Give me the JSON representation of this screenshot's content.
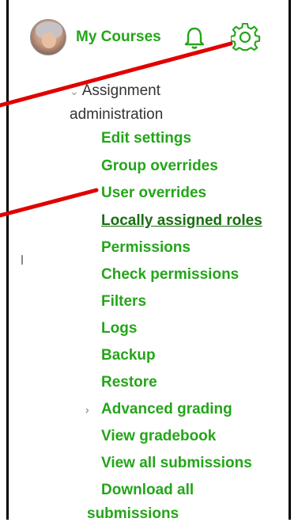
{
  "header": {
    "my_courses_label": "My Courses"
  },
  "icons": {
    "avatar": "user-avatar",
    "bell": "bell-icon",
    "gear": "gear-icon"
  },
  "section": {
    "title_line1": "Assignment",
    "title_line2": "administration"
  },
  "menu": {
    "items": [
      {
        "label": "Edit settings"
      },
      {
        "label": "Group overrides"
      },
      {
        "label": "User overrides"
      },
      {
        "label": "Locally assigned roles"
      },
      {
        "label": "Permissions"
      },
      {
        "label": "Check permissions"
      },
      {
        "label": "Filters"
      },
      {
        "label": "Logs"
      },
      {
        "label": "Backup"
      },
      {
        "label": "Restore"
      },
      {
        "label": "Advanced grading"
      },
      {
        "label": "View gradebook"
      },
      {
        "label": "View all submissions"
      }
    ],
    "download_line1": "Download all",
    "download_line2": "submissions"
  },
  "colors": {
    "link": "#24a519",
    "active": "#1a6e12",
    "arrow": "#e00000",
    "header_text": "#333333"
  }
}
